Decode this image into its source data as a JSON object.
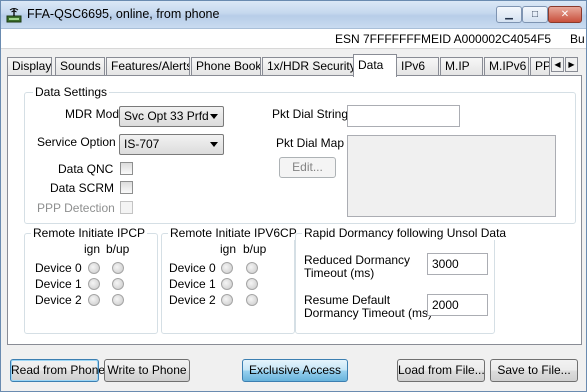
{
  "window": {
    "title": "FFA-QSC6695, online, from phone",
    "icon": "phone-antenna-icon"
  },
  "status": {
    "esn": "ESN 7FFFFFFF",
    "meid": "MEID A000002C4054F5",
    "extra": "Bu"
  },
  "tabs": [
    "Display",
    "Sounds",
    "Features/Alerts",
    "Phone Book",
    "1x/HDR Security",
    "Data",
    "IPv6",
    "M.IP",
    "M.IPv6",
    "PP"
  ],
  "active_tab": "Data",
  "data_settings": {
    "legend": "Data Settings",
    "mdr_mode_label": "MDR Mode",
    "mdr_mode_value": "Svc Opt 33 Prfd",
    "service_option_label": "Service Option",
    "service_option_value": "IS-707",
    "data_qnc_label": "Data QNC",
    "data_scrm_label": "Data SCRM",
    "ppp_detection_label": "PPP Detection",
    "pkt_dial_string_label": "Pkt Dial String",
    "pkt_dial_string_value": "",
    "pkt_dial_map_label": "Pkt Dial Map",
    "edit_label": "Edit..."
  },
  "ipcp": {
    "legend": "Remote Initiate IPCP",
    "col_ign": "ign",
    "col_bup": "b/up",
    "devices": [
      "Device 0",
      "Device 1",
      "Device 2"
    ]
  },
  "ipv6cp": {
    "legend": "Remote Initiate IPV6CP",
    "col_ign": "ign",
    "col_bup": "b/up",
    "devices": [
      "Device 0",
      "Device 1",
      "Device 2"
    ]
  },
  "dormancy": {
    "legend": "Rapid Dormancy following Unsol Data",
    "reduced_label_1": "Reduced Dormancy",
    "reduced_label_2": "Timeout (ms)",
    "reduced_value": "3000",
    "resume_label_1": "Resume Default",
    "resume_label_2": "Dormancy Timeout (ms)",
    "resume_value": "2000"
  },
  "buttons": {
    "read": "Read from Phone",
    "write": "Write to Phone",
    "exclusive": "Exclusive Access",
    "load": "Load from File...",
    "save": "Save to File..."
  },
  "colors": {
    "title_bar": "#c5d8ee",
    "close_button": "#c9503c",
    "exclusive_button": "#98d1ef"
  }
}
